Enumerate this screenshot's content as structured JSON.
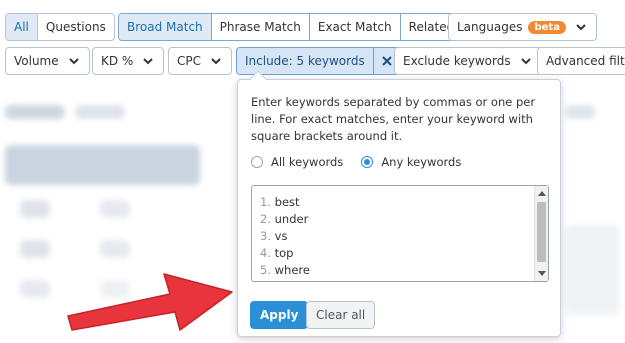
{
  "filters_row1": {
    "type_tabs": [
      "All",
      "Questions"
    ],
    "match_tabs": [
      "Broad Match",
      "Phrase Match",
      "Exact Match",
      "Related"
    ],
    "languages": {
      "label": "Languages",
      "badge": "beta"
    }
  },
  "filters_row2": {
    "volume": "Volume",
    "kd": "KD %",
    "cpc": "CPC",
    "include": "Include: 5 keywords",
    "exclude": "Exclude keywords",
    "advanced": "Advanced filte"
  },
  "popup": {
    "instructions": "Enter keywords separated by commas or one per line. For exact matches, enter your keyword with square brackets around it.",
    "radio_all": "All keywords",
    "radio_any": "Any keywords",
    "keywords": [
      {
        "n": "1.",
        "text": "best"
      },
      {
        "n": "2.",
        "text": "under"
      },
      {
        "n": "3.",
        "text": "vs"
      },
      {
        "n": "4.",
        "text": "top"
      },
      {
        "n": "5.",
        "text": "where"
      }
    ],
    "apply": "Apply",
    "clear": "Clear all"
  },
  "colors": {
    "accent": "#2b8fd8",
    "badge": "#f28b2f",
    "arrow": "#e8343c"
  },
  "icons": {
    "dropdown": "chevron-down-icon",
    "remove": "close-icon",
    "pointer": "arrow-icon"
  }
}
